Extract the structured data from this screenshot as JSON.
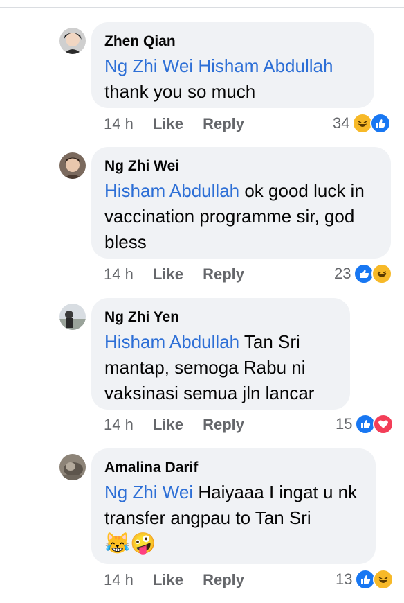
{
  "comments": [
    {
      "author": "Zhen Qian",
      "mention": "Ng Zhi Wei Hisham Abdullah",
      "text": "thank you so much",
      "time": "14 h",
      "like": "Like",
      "reply": "Reply",
      "reaction_count": "34",
      "reactions": [
        "haha-icon",
        "like-icon"
      ]
    },
    {
      "author": "Ng Zhi Wei",
      "mention": "Hisham Abdullah",
      "text": " ok good luck in vaccination programme sir, god bless",
      "time": "14 h",
      "like": "Like",
      "reply": "Reply",
      "reaction_count": "23",
      "reactions": [
        "like-icon",
        "haha-icon"
      ]
    },
    {
      "author": "Ng Zhi Yen",
      "mention": "Hisham Abdullah",
      "text": " Tan Sri mantap, semoga Rabu ni vaksinasi semua jln lancar",
      "time": "14 h",
      "like": "Like",
      "reply": "Reply",
      "reaction_count": "15",
      "reactions": [
        "like-icon",
        "love-icon"
      ]
    },
    {
      "author": "Amalina Darif",
      "mention": "Ng Zhi Wei",
      "text": " Haiyaaa I ingat u nk transfer angpau to Tan Sri",
      "emojis": "😹🤪",
      "time": "14 h",
      "like": "Like",
      "reply": "Reply",
      "reaction_count": "13",
      "reactions": [
        "like-icon",
        "haha-icon"
      ]
    }
  ],
  "colors": {
    "mention": "#2d6fd6",
    "bubble": "#f0f2f5",
    "meta": "#65676b",
    "like": "#1877f2",
    "haha": "#f7b928",
    "love": "#f33e58"
  }
}
